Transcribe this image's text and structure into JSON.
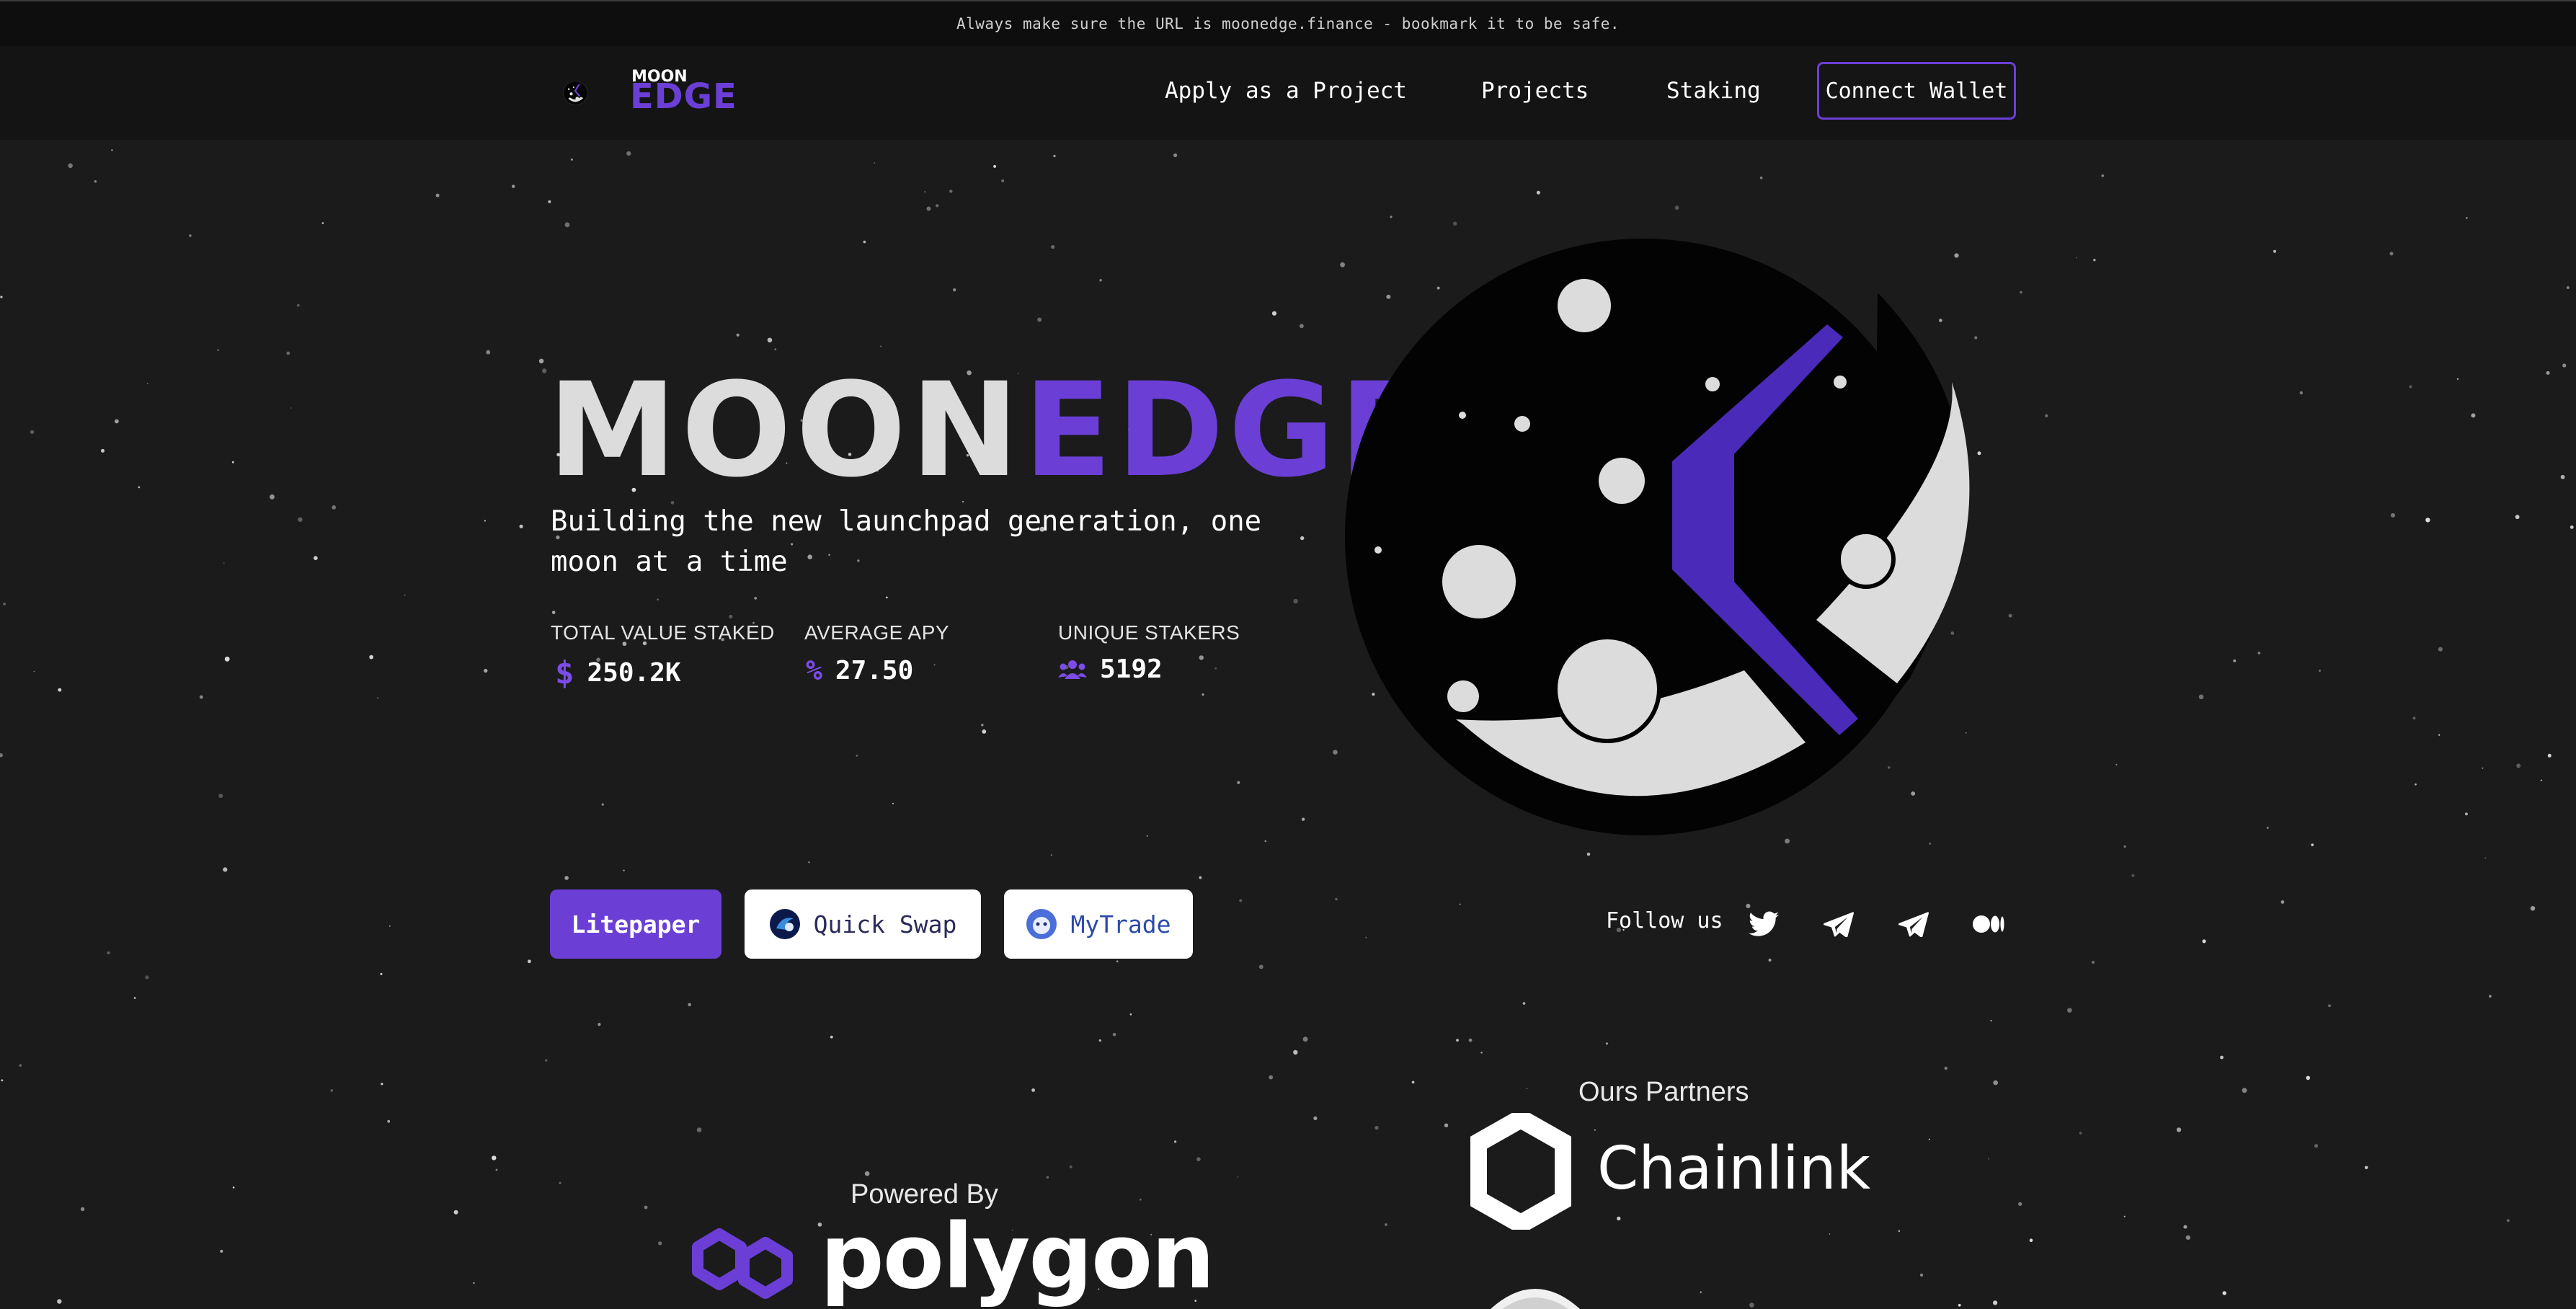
{
  "notice": {
    "text": "Always make sure the URL is moonedge.finance - bookmark it to be safe."
  },
  "brand": {
    "logo_top": "MOON",
    "logo_bottom": "EDGE"
  },
  "nav": {
    "links": [
      "Apply as a Project",
      "Projects",
      "Staking"
    ],
    "connect_wallet": "Connect Wallet"
  },
  "hero": {
    "title_part1": "MOON",
    "title_part2": "EDGE",
    "subtitle": "Building the new launchpad generation, one moon at a time"
  },
  "stats": [
    {
      "label": "TOTAL VALUE STAKED",
      "icon": "dollar-icon",
      "value": "250.2K"
    },
    {
      "label": "AVERAGE APY",
      "icon": "percent-icon",
      "value": "27.50"
    },
    {
      "label": "UNIQUE STAKERS",
      "icon": "users-icon",
      "value": "5192"
    }
  ],
  "buttons": {
    "litepaper": "Litepaper",
    "quickswap": "Quick Swap",
    "mytrade": "MyTrade"
  },
  "social": {
    "label": "Follow us",
    "icons": [
      "twitter-icon",
      "telegram-icon",
      "telegram-icon",
      "medium-icon"
    ]
  },
  "partners": {
    "title": "Ours Partners",
    "chainlink": "Chainlink"
  },
  "powered": {
    "label": "Powered By",
    "polygon": "polygon"
  },
  "colors": {
    "accent": "#6b3fd6",
    "background": "#1b1b1b",
    "moon_light": "#dcdcdc"
  }
}
